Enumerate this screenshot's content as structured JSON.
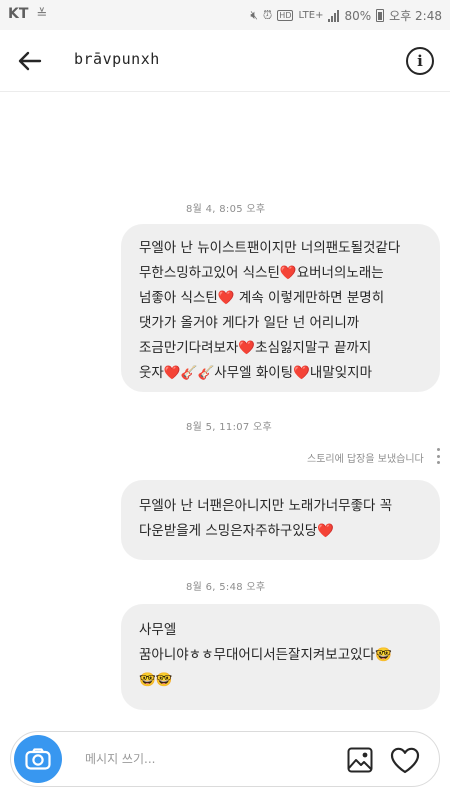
{
  "status_bar": {
    "carrier": "KT",
    "network": "LTE+",
    "battery": "80%",
    "time": "오후 2:48"
  },
  "header": {
    "title": "brāvpunxh",
    "back_icon": "arrow-left-icon",
    "info_icon": "info-icon"
  },
  "thread": {
    "timestamps": [
      "8월 4, 8:05 오후",
      "8월 5, 11:07 오후",
      "8월 6, 5:48 오후"
    ],
    "story_reply_note": "스토리에 답장을 보냈습니다",
    "messages": [
      {
        "lines": [
          "무엘아 난 뉴이스트팬이지만 너의팬도될것같다",
          "무한스밍하고있어 식스틴❤️요버너의노래는",
          "넘좋아 식스틴❤️ 계속 이렇게만하면 분명히",
          "댓가가 올거야  게다가 일단 넌 어리니까",
          "조금만기다려보자❤️초심잃지말구 끝까지",
          "웃자❤️🎸🎸사무엘 화이팅❤️내말잊지마"
        ]
      },
      {
        "lines": [
          "무엘아 난 너팬은아니지만 노래가너무좋다 꼭",
          "다운받을게 스밍은자주하구있당❤️"
        ]
      },
      {
        "lines": [
          "사무엘",
          "꿈아니야ㅎㅎ무대어디서든잘지켜보고있다🤓",
          "🤓🤓"
        ]
      }
    ]
  },
  "composer": {
    "placeholder": "메시지 쓰기...",
    "camera_icon": "camera-icon",
    "gallery_icon": "image-icon",
    "like_icon": "heart-icon"
  },
  "colors": {
    "accent": "#3897f0",
    "bubble": "#efefef",
    "text": "#262626",
    "muted": "#8e8e8e"
  }
}
